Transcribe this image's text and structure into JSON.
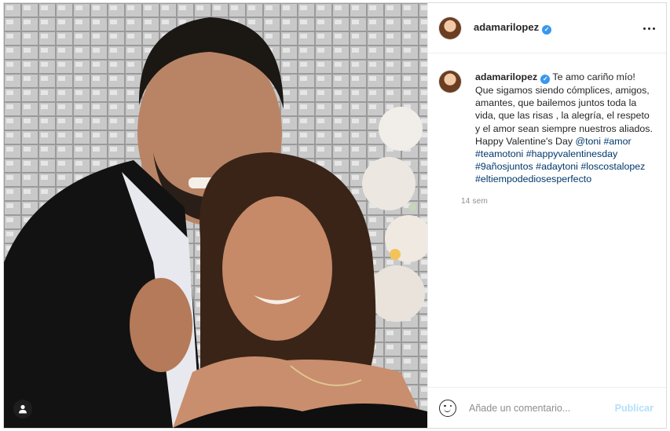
{
  "post": {
    "username": "adamarilopez",
    "verified_mark": "✓",
    "more_icon": "more-horizontal-icon",
    "caption_user": "adamarilopez",
    "caption_text": "Te amo cariño mío! Que sigamos siendo cómplices, amigos, amantes, que bailemos juntos toda la vida, que las risas , la alegría, el respeto y el amor sean siempre nuestros aliados. Happy Valentine's Day",
    "mention": "@toni",
    "hashtags": [
      "#amor",
      "#teamotoni",
      "#happyvalentinesday",
      "#9añosjuntos",
      "#adaytoni",
      "#loscostalopez",
      "#eltiempodediosesperfecto"
    ],
    "time": "14 sem"
  },
  "comment": {
    "placeholder": "Añade un comentario...",
    "publish_label": "Publicar"
  },
  "colors": {
    "link": "#00376b",
    "verified": "#3897f0",
    "publish_disabled": "#b2dffc"
  }
}
